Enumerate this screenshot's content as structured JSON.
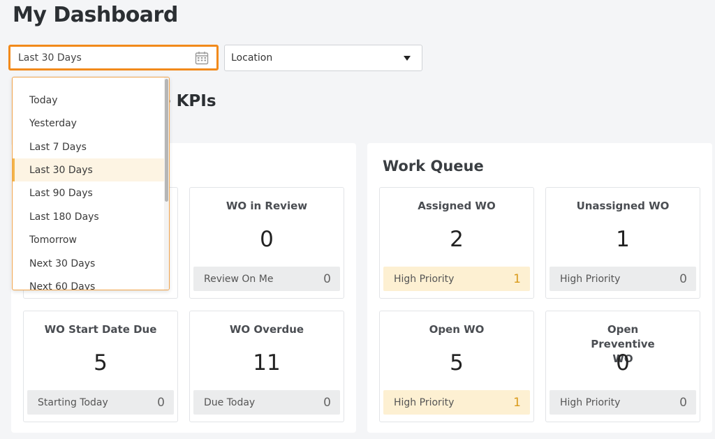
{
  "page": {
    "title": "My Dashboard"
  },
  "filters": {
    "date_range": {
      "value": "Last 30 Days",
      "icon": "calendar-icon"
    },
    "location": {
      "value": "Location",
      "icon": "chevron-down-icon"
    }
  },
  "section": {
    "heading_visible": "e KPIs"
  },
  "date_options": [
    {
      "label": "Today",
      "selected": false
    },
    {
      "label": "Yesterday",
      "selected": false
    },
    {
      "label": "Last 7 Days",
      "selected": false
    },
    {
      "label": "Last 30 Days",
      "selected": true
    },
    {
      "label": "Last 90 Days",
      "selected": false
    },
    {
      "label": "Last 180 Days",
      "selected": false
    },
    {
      "label": "Tomorrow",
      "selected": false
    },
    {
      "label": "Next 30 Days",
      "selected": false
    },
    {
      "label": "Next 60 Days",
      "selected": false
    }
  ],
  "left_panel": {
    "cards": [
      {
        "title": "WO in Review",
        "value": "0",
        "footer_label": "Review On Me",
        "footer_count": "0"
      },
      {
        "title": "WO Start Date Due",
        "value": "5",
        "footer_label": "Starting Today",
        "footer_count": "0"
      },
      {
        "title": "WO Overdue",
        "value": "11",
        "footer_label": "Due Today",
        "footer_count": "0"
      }
    ]
  },
  "work_queue": {
    "title": "Work Queue",
    "cards": [
      {
        "title": "Assigned WO",
        "value": "2",
        "footer_label": "High Priority",
        "footer_count": "1"
      },
      {
        "title": "Unassigned WO",
        "value": "1",
        "footer_label": "High Priority",
        "footer_count": "0"
      },
      {
        "title": "Open WO",
        "value": "5",
        "footer_label": "High Priority",
        "footer_count": "1"
      },
      {
        "title": "Open Preventive WO",
        "value": "0",
        "footer_label": "High Priority",
        "footer_count": "0"
      }
    ]
  },
  "colors": {
    "accent": "#f28a1b",
    "warning_bg": "#fdf0d2",
    "warning_text": "#d99a1a"
  }
}
